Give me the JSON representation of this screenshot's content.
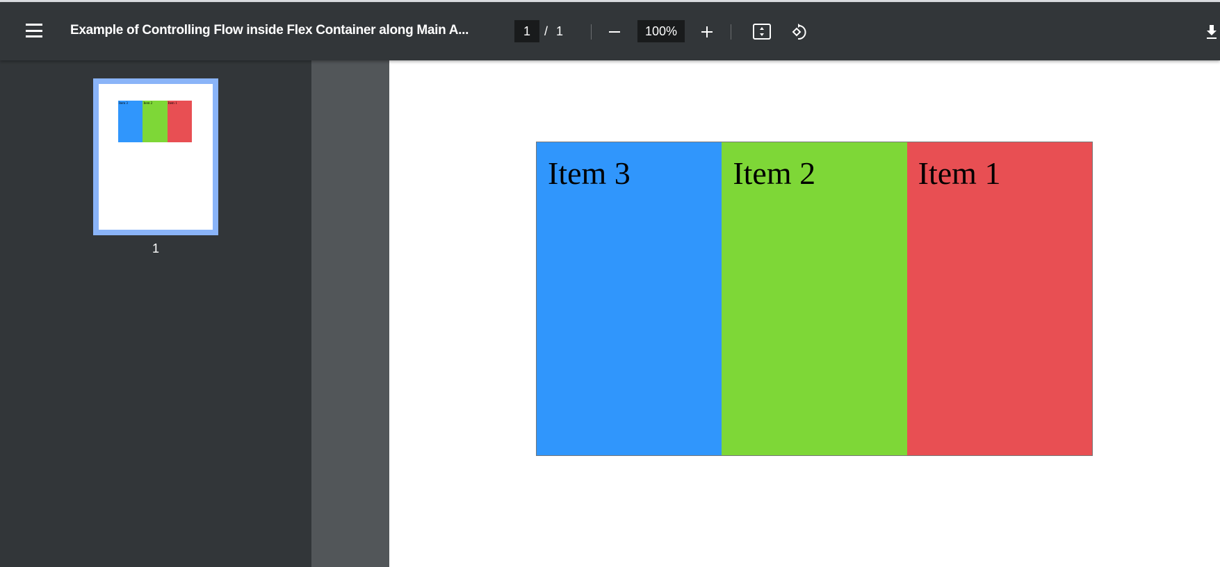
{
  "toolbar": {
    "title": "Example of Controlling Flow inside Flex Container along Main A...",
    "page_current": "1",
    "page_separator": "/",
    "page_total": "1",
    "zoom": "100%"
  },
  "thumbnail": {
    "label": "1"
  },
  "document": {
    "items": [
      {
        "label": "Item 3",
        "color": "#3096fc"
      },
      {
        "label": "Item 2",
        "color": "#7ed737"
      },
      {
        "label": "Item 1",
        "color": "#e84f53"
      }
    ]
  }
}
